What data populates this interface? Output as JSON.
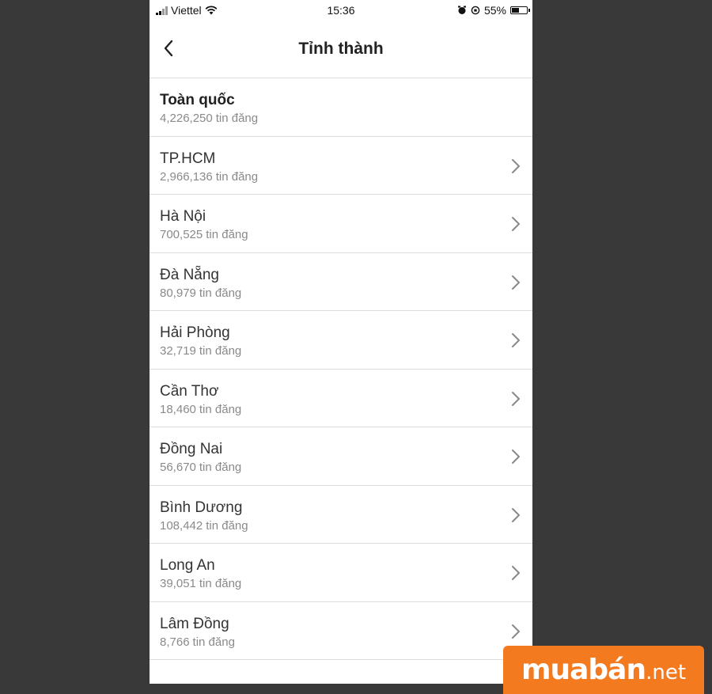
{
  "status_bar": {
    "carrier": "Viettel",
    "time": "15:36",
    "battery": "55%",
    "battery_level": 0.55
  },
  "nav": {
    "title": "Tỉnh thành"
  },
  "list": {
    "suffix": "tin đăng",
    "items": [
      {
        "name": "Toàn quốc",
        "count": "4,226,250"
      },
      {
        "name": "TP.HCM",
        "count": "2,966,136"
      },
      {
        "name": "Hà Nội",
        "count": "700,525"
      },
      {
        "name": "Đà Nẵng",
        "count": "80,979"
      },
      {
        "name": "Hải Phòng",
        "count": "32,719"
      },
      {
        "name": "Cần Thơ",
        "count": "18,460"
      },
      {
        "name": "Đồng Nai",
        "count": "56,670"
      },
      {
        "name": "Bình Dương",
        "count": "108,442"
      },
      {
        "name": "Long An",
        "count": "39,051"
      },
      {
        "name": "Lâm Đồng",
        "count": "8,766"
      }
    ]
  },
  "brand": {
    "name": "muabán",
    "suffix": ".net",
    "color": "#f47a20"
  },
  "icons": [
    "signal-icon",
    "wifi-icon",
    "alarm-icon",
    "rotation-lock-icon",
    "battery-icon",
    "back-chevron-icon",
    "chevron-right-icon"
  ]
}
